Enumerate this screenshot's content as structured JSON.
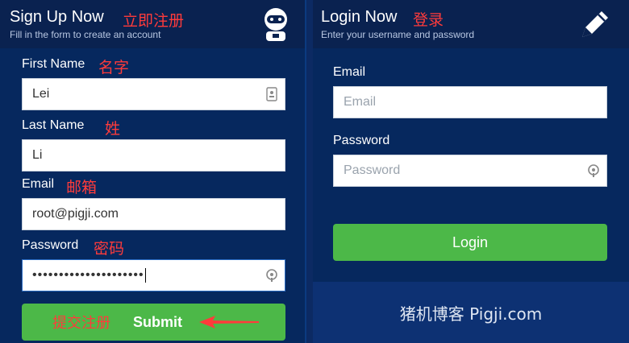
{
  "signup": {
    "title": "Sign Up Now",
    "title_cn": "立即注册",
    "subtitle": "Fill in the form to create an account",
    "icon": "robot-avatar-icon",
    "fields": {
      "first_name": {
        "label": "First Name",
        "label_cn": "名字",
        "value": "Lei"
      },
      "last_name": {
        "label": "Last Name",
        "label_cn": "姓",
        "value": "Li"
      },
      "email": {
        "label": "Email",
        "label_cn": "邮箱",
        "value": "root@pigji.com"
      },
      "password": {
        "label": "Password",
        "label_cn": "密码",
        "value": "•••••••••••••••••••••"
      }
    },
    "submit_label": "Submit",
    "submit_cn": "提交注册"
  },
  "login": {
    "title": "Login Now",
    "title_cn": "登录",
    "subtitle": "Enter your username and password",
    "icon": "pencil-icon",
    "email_label": "Email",
    "email_placeholder": "Email",
    "password_label": "Password",
    "password_placeholder": "Password",
    "button_label": "Login"
  },
  "footer": {
    "text": "猪机博客 Pigji.com"
  },
  "colors": {
    "panel": "#06285e",
    "header": "#0a2250",
    "button": "#4cb848",
    "annotation": "#ff3b3b"
  }
}
